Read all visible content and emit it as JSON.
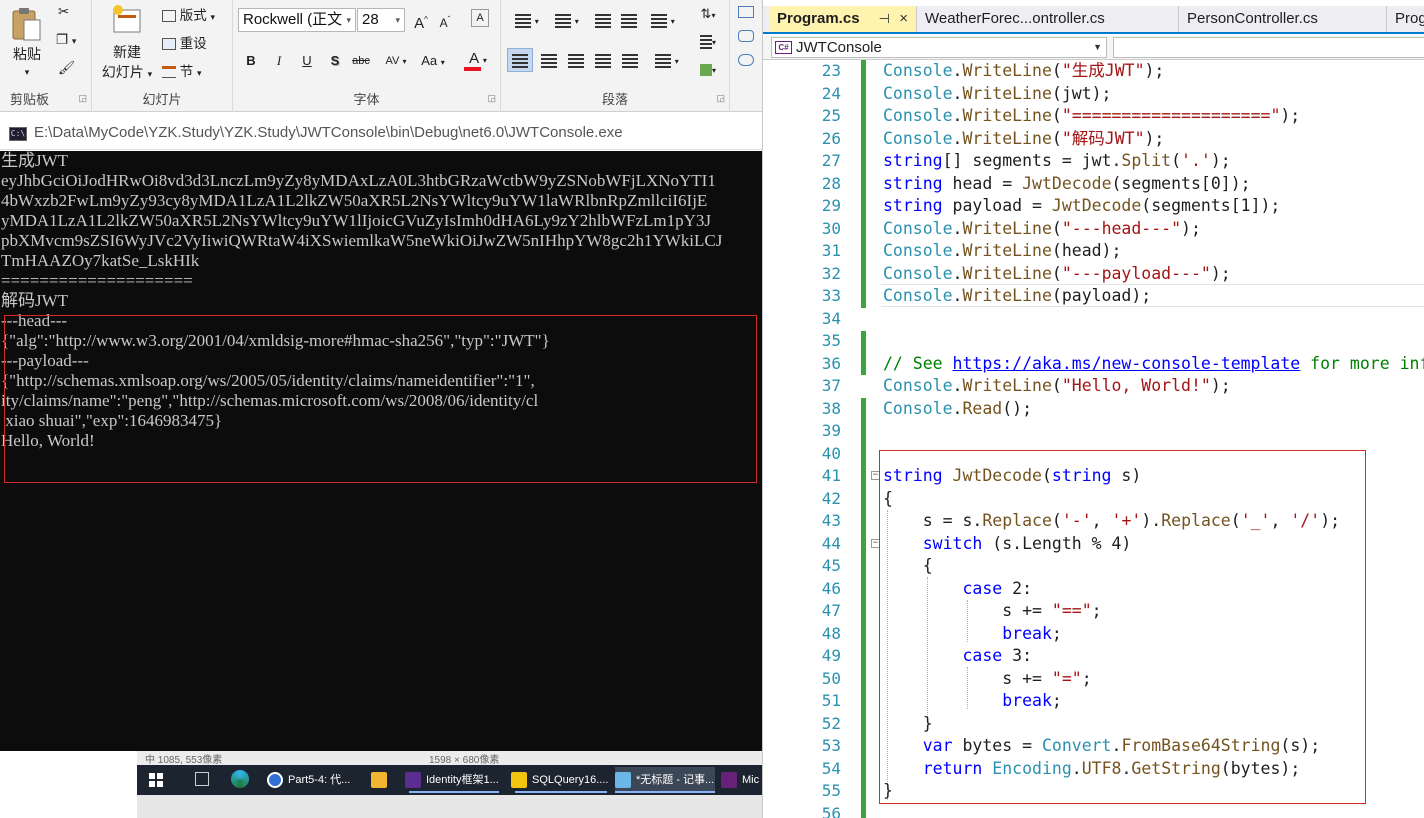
{
  "ribbon": {
    "clipboard": {
      "paste": "粘贴",
      "group": "剪贴板"
    },
    "slides": {
      "new_slide_line1": "新建",
      "new_slide_line2": "幻灯片",
      "layout": "版式",
      "reset": "重设",
      "section": "节",
      "group": "幻灯片"
    },
    "font": {
      "name": "Rockwell (正文",
      "size": "28",
      "group": "字体",
      "bold": "B",
      "italic": "I",
      "underline": "U",
      "shadow": "S",
      "strike": "abc",
      "spacing": "AV",
      "case": "Aa",
      "color_letter": "A",
      "grow": "A",
      "shrink": "A"
    },
    "paragraph": {
      "group": "段落"
    }
  },
  "console": {
    "title": "E:\\Data\\MyCode\\YZK.Study\\YZK.Study\\JWTConsole\\bin\\Debug\\net6.0\\JWTConsole.exe",
    "icon_text": "C:\\",
    "lines": [
      "生成JWT",
      "eyJhbGciOiJodHRwOi8vd3d3LnczLm9yZy8yMDAxLzA0L3htbGRzaWctbW9yZSNobWFjLXNoYTI1",
      "4bWxzb2FwLm9yZy93cy8yMDA1LzA1L2lkZW50aXR5L2NsYWltcy9uYW1laWRlbnRpZmllciI6IjE",
      "yMDA1LzA1L2lkZW50aXR5L2NsYWltcy9uYW1lIjoicGVuZyIsImh0dHA6Ly9zY2hlbWFzLm1pY3J",
      "pbXMvcm9sZSI6WyJVc2VyIiwiQWRtaW4iXSwiemlkaW5neWkiOiJwZW5nIHhpYW8gc2h1YWkiLCJ",
      "TmHAAZOy7katSe_LskHIk",
      "====================",
      "解码JWT",
      "---head---",
      "{\"alg\":\"http://www.w3.org/2001/04/xmldsig-more#hmac-sha256\",\"typ\":\"JWT\"}",
      "---payload---",
      "{\"http://schemas.xmlsoap.org/ws/2005/05/identity/claims/nameidentifier\":\"1\",",
      "ity/claims/name\":\"peng\",\"http://schemas.microsoft.com/ws/2008/06/identity/cl",
      " xiao shuai\",\"exp\":1646983475}",
      "Hello, World!"
    ]
  },
  "status_strip": {
    "left": "中 1085, 553像素",
    "right": "1598 × 680像素"
  },
  "taskbar": {
    "items": [
      {
        "label": "Part5-4: 代...",
        "color": "#2f6fd6"
      },
      {
        "label": "",
        "color": "#f2b632"
      },
      {
        "label": "Identity框架1...",
        "color": "#5c2d91"
      },
      {
        "label": "SQLQuery16....",
        "color": "#f1c40f"
      },
      {
        "label": "*无标题 - 记事...",
        "color": "#6ab7e8"
      },
      {
        "label": "Mic",
        "color": "#68217a"
      }
    ]
  },
  "vs": {
    "tabs": [
      {
        "label": "Program.cs",
        "active": true
      },
      {
        "label": "WeatherForec...ontroller.cs"
      },
      {
        "label": "PersonController.cs"
      },
      {
        "label": "Prog"
      }
    ],
    "pin_glyph": "⊣",
    "close_glyph": "×",
    "nav_scope": "JWTConsole",
    "nav_badge": "C#",
    "line_numbers": [
      "23",
      "24",
      "25",
      "26",
      "27",
      "28",
      "29",
      "30",
      "31",
      "32",
      "33",
      "34",
      "35",
      "36",
      "37",
      "38",
      "39",
      "40",
      "41",
      "42",
      "43",
      "44",
      "45",
      "46",
      "47",
      "48",
      "49",
      "50",
      "51",
      "52",
      "53",
      "54",
      "55",
      "56"
    ]
  }
}
